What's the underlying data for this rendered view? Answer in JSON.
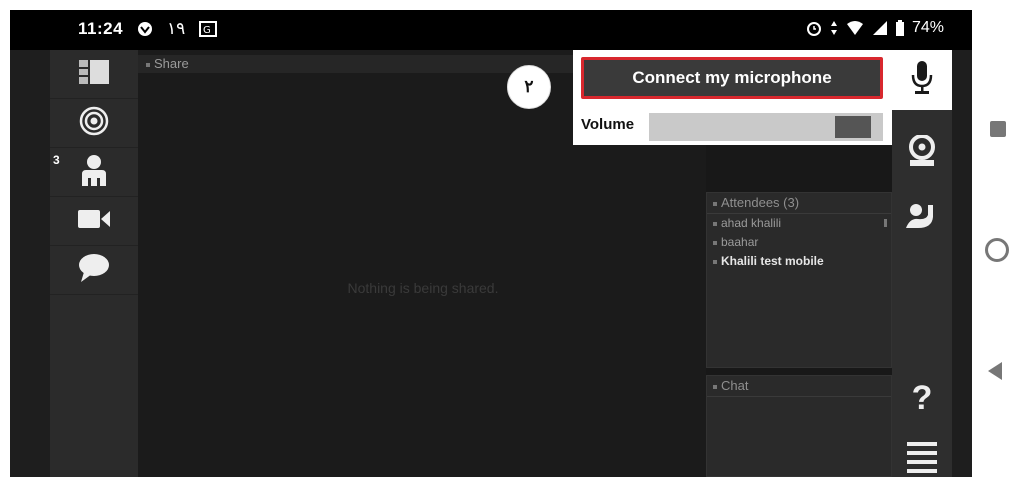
{
  "statusbar": {
    "time": "11:24",
    "notification_number": "١٩",
    "battery": "74%",
    "icons": [
      "vpn-icon",
      "translate-icon",
      "alarm-icon",
      "data-arrows-icon",
      "wifi-icon",
      "signal-icon",
      "battery-icon"
    ]
  },
  "sidebar": {
    "items": [
      {
        "icon": "layout-icon"
      },
      {
        "icon": "broadcast-icon"
      },
      {
        "icon": "participant-icon",
        "badge": "3"
      },
      {
        "icon": "video-camera-icon"
      },
      {
        "icon": "chat-bubble-icon"
      }
    ]
  },
  "share": {
    "title": "Share",
    "empty_message": "Nothing is being shared."
  },
  "mic_popup": {
    "connect_label": "Connect my microphone",
    "volume_label": "Volume",
    "volume_level": 0.8
  },
  "marker": {
    "label": "٢"
  },
  "attendees": {
    "title": "Attendees (3)",
    "list": [
      {
        "name": "ahad khalili"
      },
      {
        "name": "baahar"
      },
      {
        "name": "Khalili test mobile"
      }
    ]
  },
  "chat": {
    "title": "Chat"
  },
  "toolbar": {
    "items": [
      "microphone-icon",
      "webcam-icon",
      "raise-hand-icon",
      "help-icon",
      "menu-icon"
    ],
    "help_label": "?"
  },
  "colors": {
    "highlight": "#d8282e",
    "background": "#1e1e1e",
    "button": "#3a3a3a"
  }
}
